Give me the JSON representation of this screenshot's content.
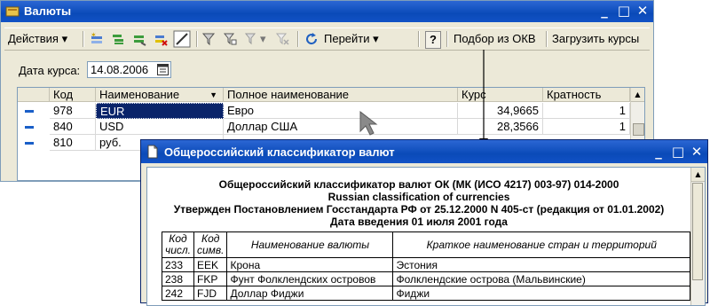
{
  "main_window": {
    "title": "Валюты",
    "toolbar": {
      "actions_label": "Действия",
      "goto_label": "Перейти",
      "help_label": "?",
      "okv_label": "Подбор из ОКВ",
      "load_rates_label": "Загрузить курсы"
    },
    "date_label": "Дата курса:",
    "date_value": "14.08.2006",
    "columns": [
      "Код",
      "Наименование",
      "Полное наименование",
      "Курс",
      "Кратность"
    ],
    "rows": [
      {
        "code": "978",
        "name": "EUR",
        "full_name": "Евро",
        "rate": "34,9665",
        "multiplicity": "1"
      },
      {
        "code": "840",
        "name": "USD",
        "full_name": "Доллар США",
        "rate": "28,3566",
        "multiplicity": "1"
      },
      {
        "code": "810",
        "name": "руб.",
        "full_name": "",
        "rate": "",
        "multiplicity": ""
      }
    ]
  },
  "okv_window": {
    "title": "Общероссийский классификатор валют",
    "heading_line1": "Общероссийский классификатор валют ОК (МК (ИСО 4217) 003-97) 014-2000",
    "heading_line2": "Russian classification of currencies",
    "heading_line3": "Утвержден Постановлением Госстандарта РФ от 25.12.2000 N 405-ст (редакция от 01.01.2002)",
    "heading_line4": "Дата введения 01 июля 2001 года",
    "columns": [
      "Код числ.",
      "Код симв.",
      "Наименование валюты",
      "Краткое наименование стран и территорий"
    ],
    "rows": [
      {
        "num": "233",
        "sym": "EEK",
        "name": "Крона",
        "country": "Эстония"
      },
      {
        "num": "238",
        "sym": "FKP",
        "name": "Фунт Фолклендских островов",
        "country": "Фолклендские острова (Мальвинские)"
      },
      {
        "num": "242",
        "sym": "FJD",
        "name": "Доллар Фиджи",
        "country": "Фиджи"
      }
    ]
  }
}
